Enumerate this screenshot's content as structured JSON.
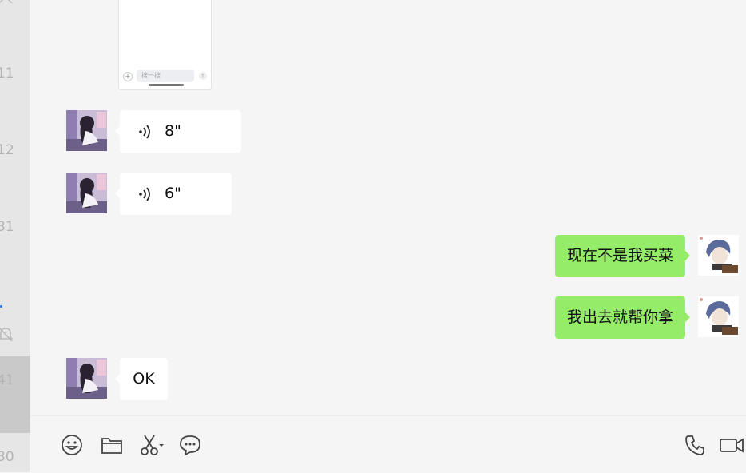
{
  "sidebar": {
    "partial_times": [
      "11",
      "12",
      "31",
      "41",
      "30"
    ]
  },
  "preview_card": {
    "input_placeholder": "搜一搜",
    "plus_glyph": "+",
    "send_glyph": "↑"
  },
  "messages": [
    {
      "type": "voice",
      "direction": "in",
      "duration": "8\""
    },
    {
      "type": "voice",
      "direction": "in",
      "duration": "6\""
    },
    {
      "type": "text",
      "direction": "out",
      "text": "现在不是我买菜"
    },
    {
      "type": "text",
      "direction": "out",
      "text": "我出去就帮你拿"
    },
    {
      "type": "text",
      "direction": "in",
      "text": "OK"
    }
  ],
  "toolbar": {
    "icons": [
      "emoji-icon",
      "folder-icon",
      "scissors-icon",
      "chat-bubble-icon",
      "phone-icon",
      "video-icon"
    ]
  },
  "colors": {
    "outgoing_bubble": "#95ec69",
    "incoming_bubble": "#ffffff",
    "background": "#f5f5f5"
  }
}
